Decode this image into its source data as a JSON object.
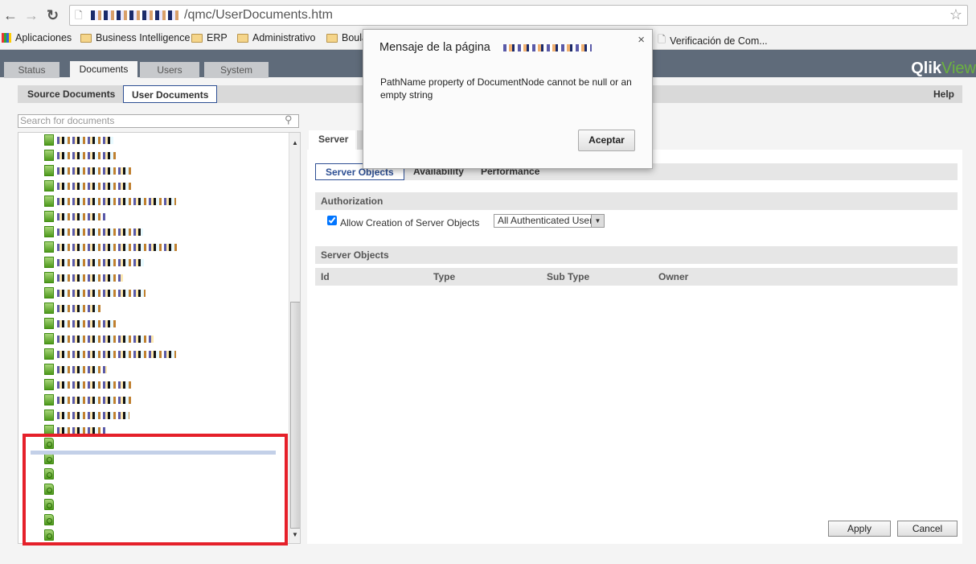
{
  "browser": {
    "url_visible": "/qmc/UserDocuments.htm",
    "bookmarks": [
      "Aplicaciones",
      "Business Intelligence",
      "ERP",
      "Administrativo",
      "Boula",
      "Verificación de Com..."
    ]
  },
  "app": {
    "tabs": [
      "Status",
      "Documents",
      "Users",
      "System"
    ],
    "active_tab": "Documents",
    "logo": {
      "a": "Qlik",
      "b": "View"
    },
    "subtabs": [
      "Source Documents",
      "User Documents"
    ],
    "help": "Help"
  },
  "tree": {
    "search_placeholder": "Search for documents",
    "named_items": 20,
    "unnamed_items": 7
  },
  "panel": {
    "tab": "Server",
    "inner_tabs": [
      "Server Objects",
      "Availability",
      "Performance"
    ],
    "authorization": {
      "title": "Authorization",
      "checkbox_label": "Allow Creation of Server Objects",
      "checked": true,
      "select_value": "All Authenticated Users"
    },
    "server_objects": {
      "title": "Server Objects",
      "columns": [
        "Id",
        "Type",
        "Sub Type",
        "Owner"
      ]
    },
    "apply": "Apply",
    "cancel": "Cancel"
  },
  "dialog": {
    "title": "Mensaje de la página",
    "message": "PathName property of DocumentNode cannot be null or an empty string",
    "ok": "Aceptar",
    "close": "×"
  },
  "colors": {
    "header": "#5f6b7a",
    "accent": "#2d4f93",
    "highlight": "#e5202a"
  }
}
